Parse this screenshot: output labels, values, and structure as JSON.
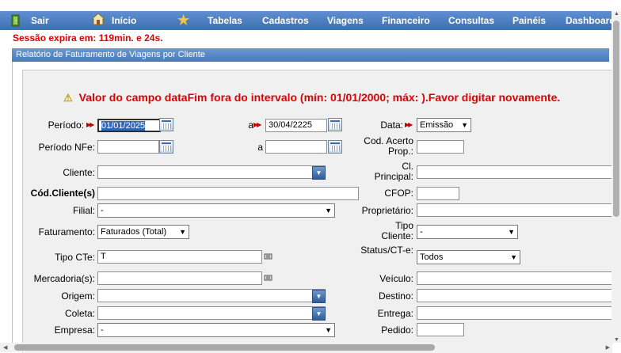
{
  "menu": {
    "sair": "Sair",
    "inicio": "Início",
    "items": [
      "Tabelas",
      "Cadastros",
      "Viagens",
      "Financeiro",
      "Consultas",
      "Painéis",
      "Dashboard"
    ]
  },
  "session": "Sessão expira em: 119min. e 24s.",
  "panel_title": "Relatório de Faturamento de Viagens por Cliente",
  "warning": "Valor do campo dataFim fora do intervalo (mín: 01/01/2000; máx: ).Favor digitar novamente.",
  "form": {
    "periodo_label": "Período:",
    "periodo_inicio": "01/01/2025",
    "a_label": "a",
    "periodo_fim": "30/04/2225",
    "data_label": "Data:",
    "data_value": "Emissão",
    "periodo_nfe_label": "Período NFe:",
    "a2_label": "a",
    "cod_acerto_label": "Cod. Acerto Prop.:",
    "cliente_label": "Cliente:",
    "cl_principal_label": "Cl. Principal:",
    "cod_cliente_label": "Cód.Cliente(s)",
    "cfop_label": "CFOP:",
    "filial_label": "Filial:",
    "filial_value": "-",
    "proprietario_label": "Proprietário:",
    "faturamento_label": "Faturamento:",
    "faturamento_value": "Faturados (Total)",
    "tipo_cliente_label": "Tipo Cliente:",
    "tipo_cliente_value": "-",
    "tipo_cte_label": "Tipo CTe:",
    "tipo_cte_value": "T",
    "status_cte_label": "Status/CT-e:",
    "status_cte_value": "Todos",
    "mercadorias_label": "Mercadoria(s):",
    "veiculo_label": "Veículo:",
    "origem_label": "Origem:",
    "destino_label": "Destino:",
    "coleta_label": "Coleta:",
    "entrega_label": "Entrega:",
    "empresa_label": "Empresa:",
    "empresa_value": "-",
    "pedido_label": "Pedido:"
  }
}
